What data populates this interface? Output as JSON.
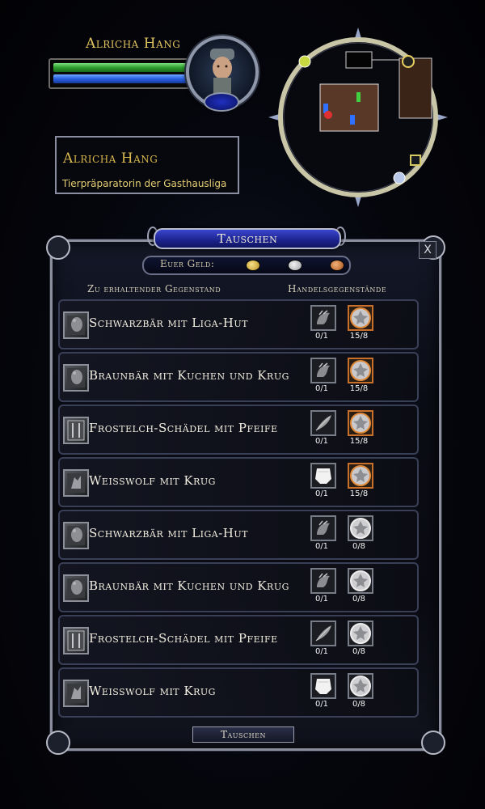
{
  "player": {
    "name": "Alricha Hang",
    "morale_fraction": 1.0,
    "power_fraction": 1.0
  },
  "target": {
    "name": "Alricha Hang",
    "title": "Tierpräparatorin der Gasthausliga"
  },
  "trade": {
    "window_title": "Tauschen",
    "money_label": "Euer Geld:",
    "col_receive": "Zu erhaltender Gegenstand",
    "col_trade": "Handelsgegenstände",
    "close_label": "X",
    "button_label": "Tauschen",
    "rows": [
      {
        "label": "Schwarzbär mit Liga-Hut",
        "icon": "bear-trophy-icon",
        "item1_icon": "paw-token-icon",
        "item1_count": "0/1",
        "item2_icon": "orange-leaf-medallion-icon",
        "item2_count": "15/8"
      },
      {
        "label": "Braunbär mit Kuchen und Krug",
        "icon": "bear-trophy-icon",
        "item1_icon": "paw-token-icon",
        "item1_count": "0/1",
        "item2_icon": "orange-leaf-medallion-icon",
        "item2_count": "15/8"
      },
      {
        "label": "Frostelch-Schädel mit Pfeife",
        "icon": "elk-trophy-icon",
        "item1_icon": "feather-token-icon",
        "item1_count": "0/1",
        "item2_icon": "orange-leaf-medallion-icon",
        "item2_count": "15/8"
      },
      {
        "label": "Weisswolf mit Krug",
        "icon": "wolf-trophy-icon",
        "item1_icon": "pelt-token-icon",
        "item1_count": "0/1",
        "item2_icon": "orange-leaf-medallion-icon",
        "item2_count": "15/8"
      },
      {
        "label": "Schwarzbär mit Liga-Hut",
        "icon": "bear-trophy-icon",
        "item1_icon": "paw-token-icon",
        "item1_count": "0/1",
        "item2_icon": "silver-leaf-medallion-icon",
        "item2_count": "0/8"
      },
      {
        "label": "Braunbär mit Kuchen und Krug",
        "icon": "bear-trophy-icon",
        "item1_icon": "paw-token-icon",
        "item1_count": "0/1",
        "item2_icon": "silver-leaf-medallion-icon",
        "item2_count": "0/8"
      },
      {
        "label": "Frostelch-Schädel mit Pfeife",
        "icon": "elk-trophy-icon",
        "item1_icon": "feather-token-icon",
        "item1_count": "0/1",
        "item2_icon": "silver-leaf-medallion-icon",
        "item2_count": "0/8"
      },
      {
        "label": "Weisswolf mit Krug",
        "icon": "wolf-trophy-icon",
        "item1_icon": "pelt-token-icon",
        "item1_count": "0/1",
        "item2_icon": "silver-leaf-medallion-icon",
        "item2_count": "0/8"
      }
    ]
  },
  "colors": {
    "name_gold": "#e0c460",
    "morale_green": "#2e9f2e",
    "power_blue": "#2a5fe0",
    "highlight_orange": "#c8702a"
  }
}
